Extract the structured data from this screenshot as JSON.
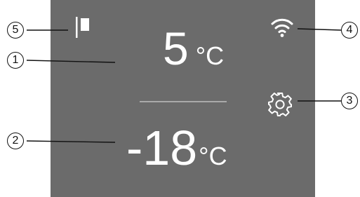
{
  "display": {
    "fridge": {
      "value": "5",
      "unit": "°C"
    },
    "freezer": {
      "value": "-18",
      "unit": "°C"
    }
  },
  "icons": {
    "door_flag": "door-flag-icon",
    "wifi": "wifi-icon",
    "settings": "gear-icon"
  },
  "callouts": {
    "c1": "1",
    "c2": "2",
    "c3": "3",
    "c4": "4",
    "c5": "5"
  },
  "colors": {
    "panel": "#6b6b6b",
    "foreground": "#ffffff",
    "separator": "#a9a9a9",
    "callout_line": "#111111"
  }
}
